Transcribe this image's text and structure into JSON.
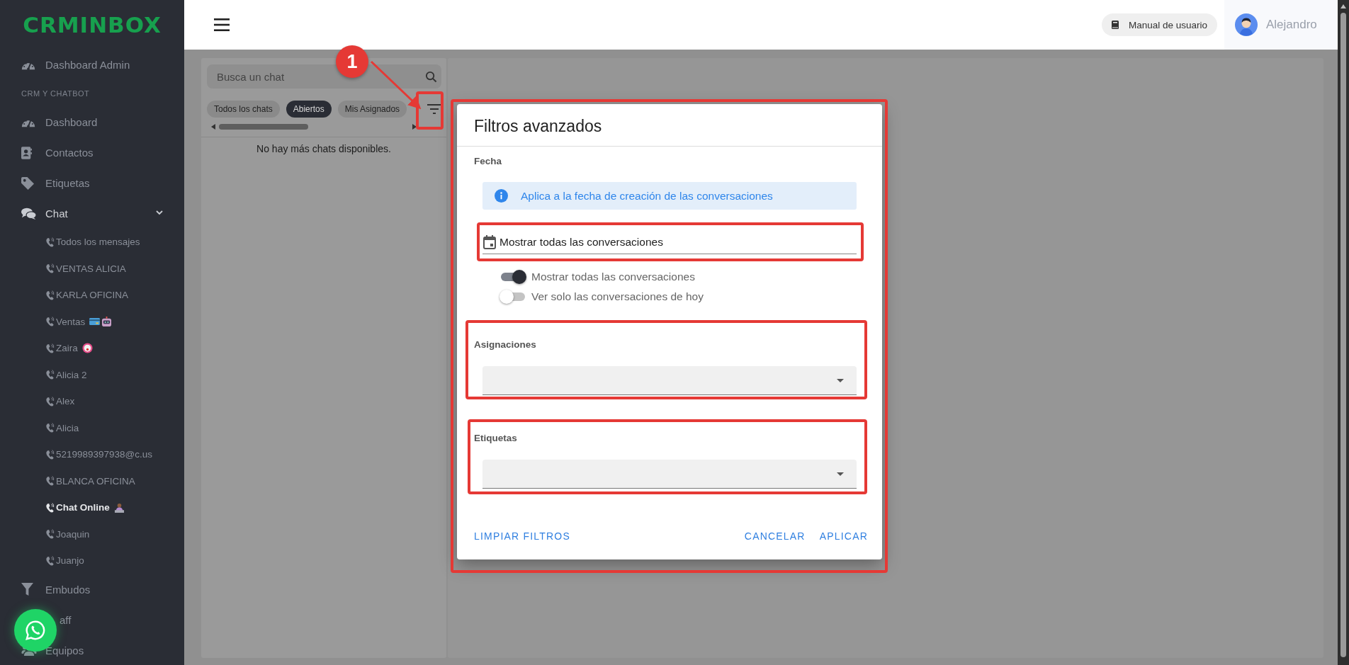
{
  "sidebar": {
    "logo": "CRMINBOX",
    "items": [
      {
        "kind": "link",
        "label": "Dashboard Admin",
        "selected": false
      },
      {
        "kind": "section",
        "label": "CRM Y CHATBOT"
      },
      {
        "kind": "link",
        "label": "Dashboard",
        "selected": false
      },
      {
        "kind": "link",
        "label": "Contactos",
        "selected": false
      },
      {
        "kind": "link",
        "label": "Etiquetas",
        "selected": false
      },
      {
        "kind": "group",
        "label": "Chat",
        "expanded": true,
        "children": [
          {
            "label": "Todos los mensajes",
            "selected": false
          },
          {
            "label": "VENTAS ALICIA",
            "selected": false
          },
          {
            "label": "KARLA OFICINA",
            "selected": false
          },
          {
            "label": "Ventas",
            "selected": false
          },
          {
            "label": "Zaira",
            "selected": false
          },
          {
            "label": "Alicia 2",
            "selected": false
          },
          {
            "label": "Alex",
            "selected": false
          },
          {
            "label": "Alicia",
            "selected": false
          },
          {
            "label": "5219989397938@c.us",
            "selected": false
          },
          {
            "label": "BLANCA OFICINA",
            "selected": false
          },
          {
            "label": "Chat Online",
            "selected": true
          },
          {
            "label": "Joaquin",
            "selected": false
          },
          {
            "label": "Juanjo",
            "selected": false
          }
        ]
      },
      {
        "kind": "link",
        "label": "Embudos",
        "selected": false
      },
      {
        "kind": "link",
        "label": "aff",
        "selected": false
      },
      {
        "kind": "link",
        "label": "Equipos",
        "selected": false
      }
    ]
  },
  "header": {
    "manual_button": "Manual de usuario",
    "user": "Alejandro"
  },
  "chat_list": {
    "search": {
      "placeholder": "Busca un chat"
    },
    "chips": [
      {
        "label": "Todos los chats",
        "selected": false
      },
      {
        "label": "Abiertos",
        "selected": true
      },
      {
        "label": "Mis Asignados",
        "selected": false
      }
    ],
    "empty_message": "No hay más chats disponibles."
  },
  "dialog": {
    "title": "Filtros avanzados",
    "date": {
      "label": "Fecha",
      "info": "Aplica a la fecha de creación de las conversaciones",
      "value": "Mostrar todas las conversaciones",
      "switches": [
        {
          "label": "Mostrar todas las conversaciones",
          "on": true
        },
        {
          "label": "Ver solo las conversaciones de hoy",
          "on": false
        }
      ]
    },
    "assignments": {
      "label": "Asignaciones"
    },
    "tags": {
      "label": "Etiquetas"
    },
    "buttons": {
      "clear": "LIMPIAR FILTROS",
      "cancel": "CANCELAR",
      "apply": "APLICAR"
    }
  },
  "annotation": {
    "label": "1"
  }
}
